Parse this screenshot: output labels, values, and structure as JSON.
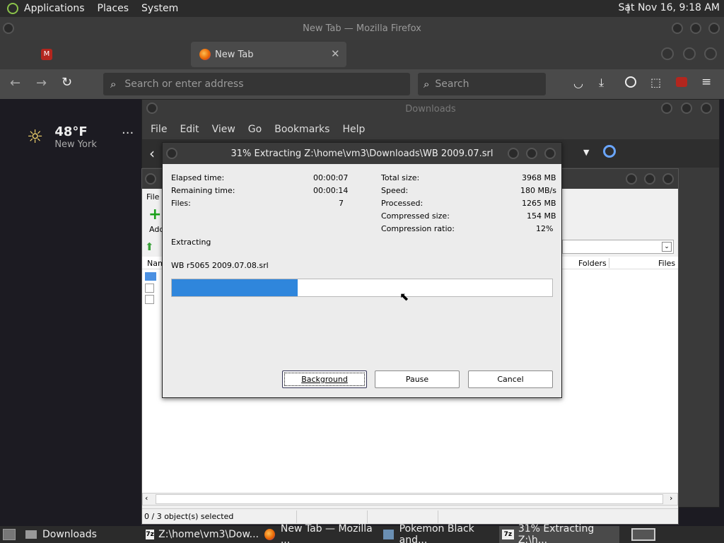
{
  "top_panel": {
    "menus": [
      "Applications",
      "Places",
      "System"
    ],
    "clock": "Sat Nov 16,  9:18 AM"
  },
  "firefox": {
    "title": "New Tab — Mozilla Firefox",
    "tab_label": "New Tab",
    "url_placeholder": "Search or enter address",
    "search_placeholder": "Search"
  },
  "weather": {
    "temp": "48°F",
    "city": "New York"
  },
  "downloads": {
    "title": "Downloads",
    "menu": [
      "File",
      "Edit",
      "View",
      "Go",
      "Bookmarks",
      "Help"
    ]
  },
  "zip": {
    "menu_file": "File",
    "add_label": "Add",
    "list_header_name": "Nam",
    "list_header_folders": "Folders",
    "list_header_files": "Files",
    "status": "0 / 3 object(s) selected"
  },
  "dialog": {
    "title": "31% Extracting Z:\\home\\vm3\\Downloads\\WB 2009.07.srl",
    "elapsed_label": "Elapsed time:",
    "elapsed_value": "00:00:07",
    "remaining_label": "Remaining time:",
    "remaining_value": "00:00:14",
    "files_label": "Files:",
    "files_value": "7",
    "total_size_label": "Total size:",
    "total_size_value": "3968 MB",
    "speed_label": "Speed:",
    "speed_value": "180 MB/s",
    "processed_label": "Processed:",
    "processed_value": "1265 MB",
    "compressed_label": "Compressed size:",
    "compressed_value": "154 MB",
    "ratio_label": "Compression ratio:",
    "ratio_value": "12%",
    "status": "Extracting",
    "current_file": "WB r5065 2009.07.08.srl",
    "progress_fraction": 0.33,
    "background_btn": "Background",
    "pause_btn": "Pause",
    "cancel_btn": "Cancel"
  },
  "taskbar": {
    "items": [
      "Downloads",
      "Z:\\home\\vm3\\Dow...",
      "New Tab — Mozilla ...",
      "Pokemon Black and...",
      "31% Extracting Z:\\h..."
    ]
  }
}
